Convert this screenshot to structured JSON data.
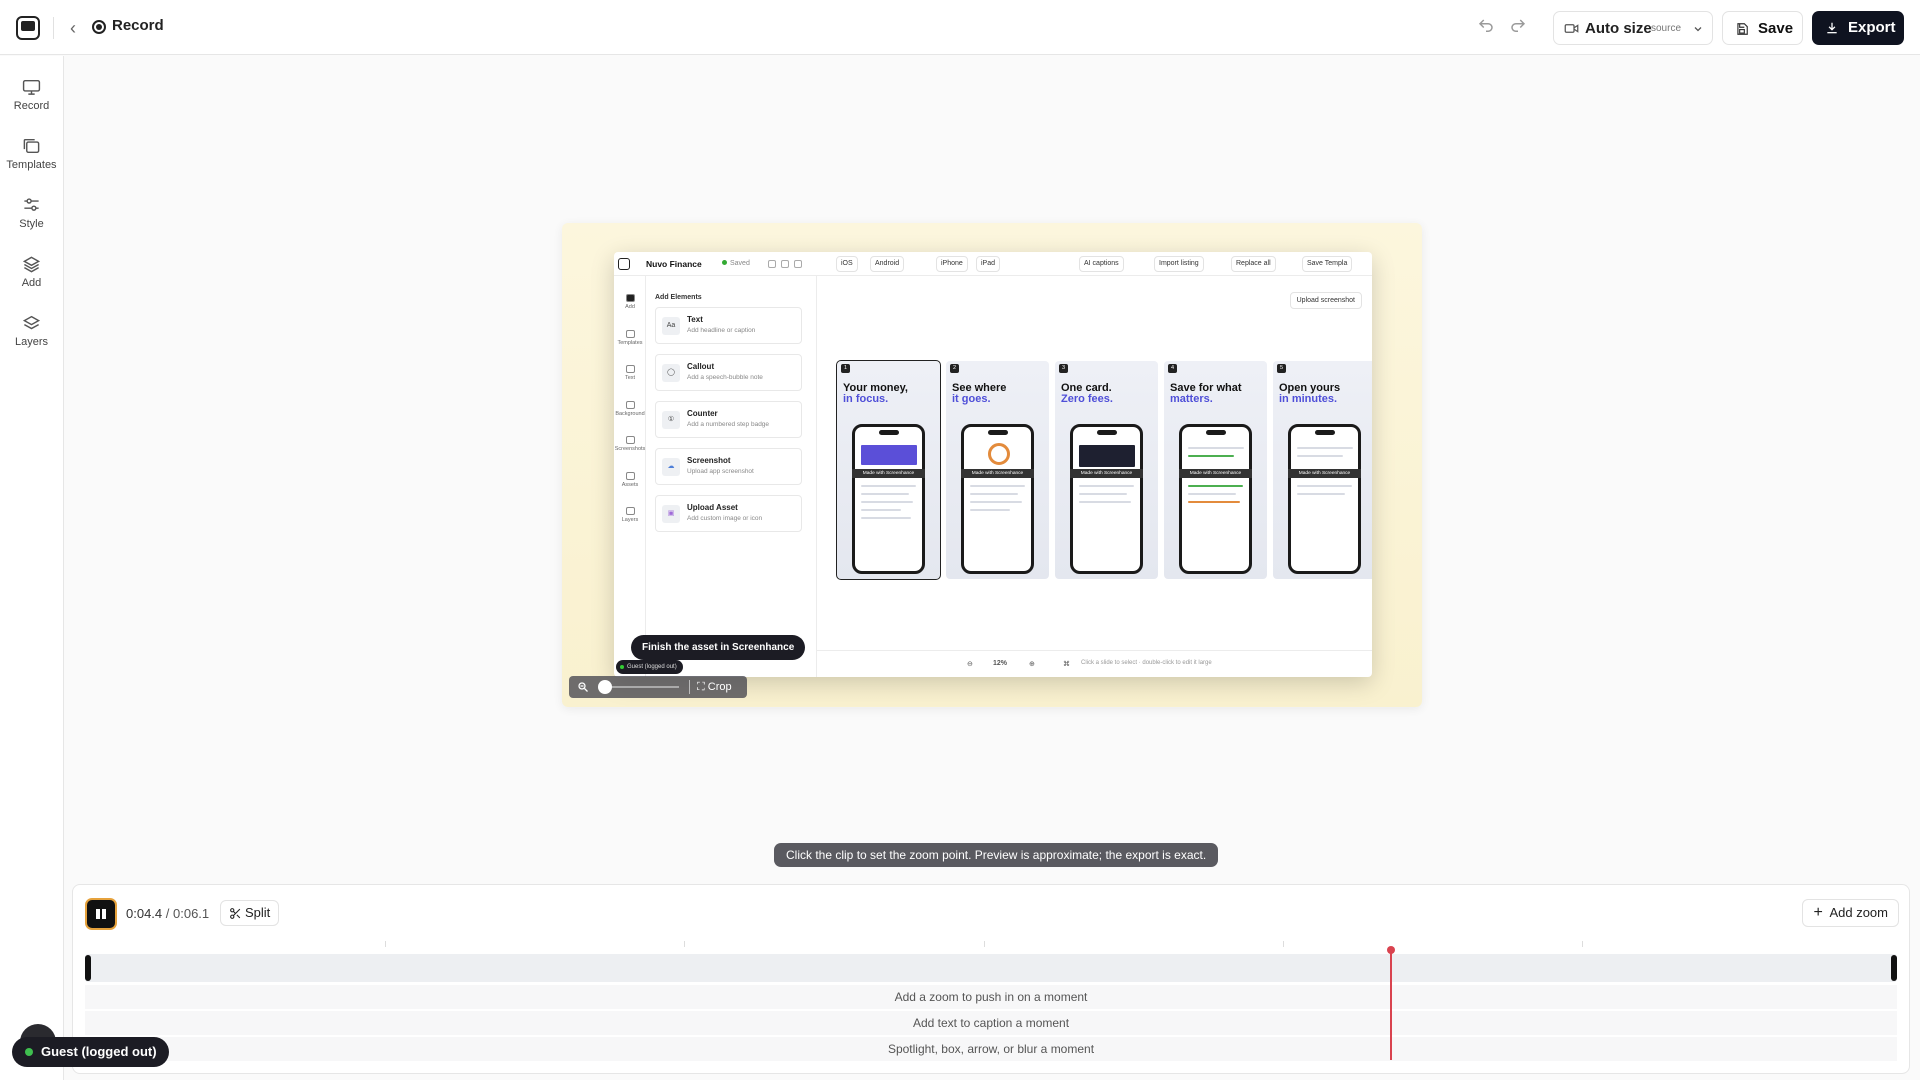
{
  "topbar": {
    "breadcrumb": "Record",
    "autosize_label": "Auto size",
    "autosize_sub": "source",
    "save_label": "Save",
    "export_label": "Export"
  },
  "sidebar": {
    "items": [
      {
        "label": "Record",
        "icon": "monitor-icon"
      },
      {
        "label": "Templates",
        "icon": "templates-icon"
      },
      {
        "label": "Style",
        "icon": "sliders-icon"
      },
      {
        "label": "Add",
        "icon": "layers-stack-icon"
      },
      {
        "label": "Layers",
        "icon": "layers-icon"
      }
    ]
  },
  "preview": {
    "app_title": "Nuvo Finance",
    "saved": "Saved",
    "pills": [
      "iOS",
      "Android",
      "iPhone",
      "iPad",
      "AI captions",
      "Import listing",
      "Replace all",
      "Save Templa"
    ],
    "rail": [
      "Add",
      "Templates",
      "Text",
      "Background",
      "Screenshots",
      "Assets",
      "Layers"
    ],
    "panel_title": "Add Elements",
    "cards": [
      {
        "title": "Text",
        "desc": "Add headline or caption",
        "icon": "Aa"
      },
      {
        "title": "Callout",
        "desc": "Add a speech-bubble note",
        "icon": "◯"
      },
      {
        "title": "Counter",
        "desc": "Add a numbered step badge",
        "icon": "①"
      },
      {
        "title": "Screenshot",
        "desc": "Upload app screenshot",
        "icon": "☁"
      },
      {
        "title": "Upload Asset",
        "desc": "Add custom image or icon",
        "icon": "▣"
      }
    ],
    "upload_label": "Upload screenshot",
    "slides": [
      {
        "num": "1",
        "line1": "Your money,",
        "line2": "in focus."
      },
      {
        "num": "2",
        "line1": "See where",
        "line2": "it goes."
      },
      {
        "num": "3",
        "line1": "One card.",
        "line2": "Zero fees."
      },
      {
        "num": "4",
        "line1": "Save for what",
        "line2": "matters."
      },
      {
        "num": "5",
        "line1": "Open yours",
        "line2": "in minutes."
      }
    ],
    "watermark": "Made with Screenhance",
    "zoom_value": "12%",
    "bottom_hint": "Click a slide to select · double-click to edit it large",
    "tooltip": "Finish the asset in Screenhance",
    "guest_small": "Guest (logged out)",
    "crop_label": "Crop"
  },
  "hint": "Click the clip to set the zoom point. Preview is approximate; the export is exact.",
  "timeline": {
    "current_time": "0:04.4",
    "total_time": "0:06.1",
    "split_label": "Split",
    "add_zoom_label": "Add zoom",
    "lanes": [
      "Add a zoom to push in on a moment",
      "Add text to caption a moment",
      "Spotlight, box, arrow, or blur a moment"
    ],
    "playhead_position": 0.72
  },
  "guest_badge": "Guest (logged out)",
  "colors": {
    "accent": "#4f4fd8",
    "dark": "#0f1320",
    "playhead": "#d9434f",
    "play_border": "#e6a23c"
  }
}
